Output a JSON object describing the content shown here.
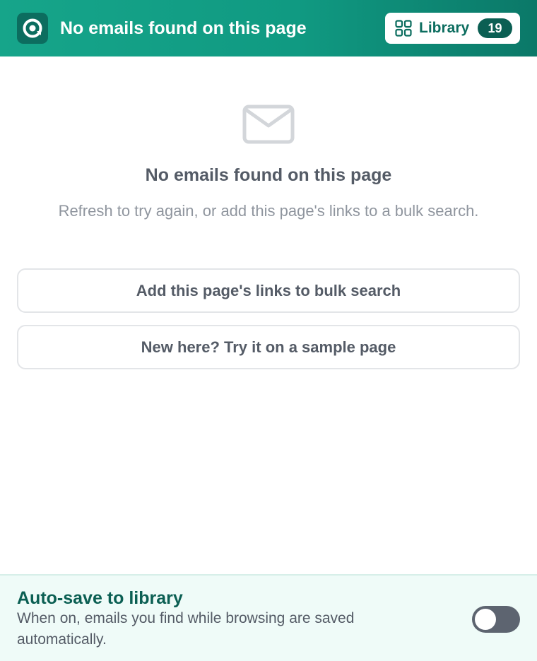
{
  "header": {
    "logo_icon": "at-sign-logo-icon",
    "title": "No emails found on this page",
    "library": {
      "icon": "grid-icon",
      "label": "Library",
      "count": "19"
    },
    "colors": {
      "gradient_start": "#16a58a",
      "gradient_end": "#0b7868",
      "accent_dark": "#0b5f53"
    }
  },
  "empty_state": {
    "icon": "mail-icon",
    "title": "No emails found on this page",
    "message": "Refresh to try again, or add this page's links to a bulk search."
  },
  "actions": {
    "bulk_search_label": "Add this page's links to bulk search",
    "sample_page_label": "New here? Try it on a sample page"
  },
  "footer": {
    "title": "Auto-save to library",
    "description": "When on, emails you find while browsing are saved automatically.",
    "toggle_on": false
  }
}
